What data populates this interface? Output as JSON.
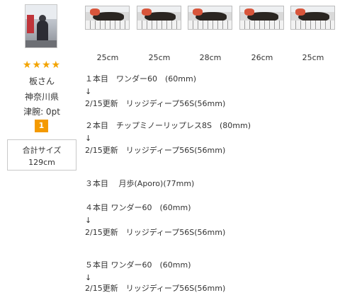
{
  "profile": {
    "stars": "★★★★",
    "username": "板さん",
    "prefecture": "神奈川県",
    "points": "津腕: 0pt",
    "rank": "1",
    "total_label": "合計サイズ",
    "total_value": "129cm"
  },
  "catches": [
    {
      "size": "25cm"
    },
    {
      "size": "25cm"
    },
    {
      "size": "28cm"
    },
    {
      "size": "26cm"
    },
    {
      "size": "25cm"
    }
  ],
  "notes": [
    "１本目　ワンダー60　(60mm)",
    "↓",
    "2/15更新　リッジディープ56S(56mm)",
    "２本目　チップミノーリップレス8S　(80mm)",
    "↓",
    "2/15更新　リッジディープ56S(56mm)",
    "３本目　 月歩(Aporo)(77mm)",
    "４本目 ワンダー60　(60mm)",
    "↓",
    "2/15更新　リッジディープ56S(56mm)",
    "５本目 ワンダー60　(60mm)",
    "↓",
    "2/15更新　リッジディープ56S(56mm)"
  ],
  "icons": {
    "avatar": "user-photo",
    "catch_photo": "fish-photo",
    "stars": "star-rating-icon"
  },
  "colors": {
    "star": "#f3a400",
    "rank_badge": "#f49a00"
  }
}
